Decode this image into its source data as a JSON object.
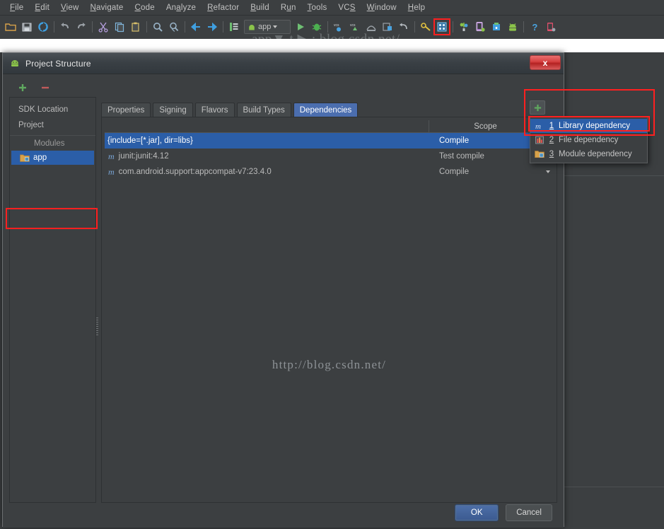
{
  "ide": {
    "menu": [
      {
        "label": "File",
        "mnemonic": "F"
      },
      {
        "label": "Edit",
        "mnemonic": "E"
      },
      {
        "label": "View",
        "mnemonic": "V"
      },
      {
        "label": "Navigate",
        "mnemonic": "N"
      },
      {
        "label": "Code",
        "mnemonic": "C"
      },
      {
        "label": "Analyze",
        "mnemonic": "A"
      },
      {
        "label": "Refactor",
        "mnemonic": "R"
      },
      {
        "label": "Build",
        "mnemonic": "B"
      },
      {
        "label": "Run",
        "mnemonic": "u"
      },
      {
        "label": "Tools",
        "mnemonic": "T"
      },
      {
        "label": "VCS",
        "mnemonic": "S"
      },
      {
        "label": "Window",
        "mnemonic": "W"
      },
      {
        "label": "Help",
        "mnemonic": "H"
      }
    ],
    "toolbar": {
      "run_config_label": "app",
      "icons": [
        "open-folder-icon",
        "save-all-icon",
        "sync-icon",
        "undo-icon",
        "redo-icon",
        "cut-icon",
        "copy-icon",
        "paste-icon",
        "find-icon",
        "replace-icon",
        "back-icon",
        "forward-icon",
        "build-icon",
        "run-config-selector",
        "run-icon",
        "debug-icon",
        "vcs-update-icon",
        "vcs-commit-icon",
        "history-icon",
        "rollback-icon",
        "sdk-manager-icon",
        "project-structure-icon",
        "avd-manager-icon",
        "device-monitor-icon",
        "android-file-icon",
        "android-monitor-icon",
        "help-icon",
        "device-icon"
      ],
      "highlighted_icon": "project-structure-icon",
      "watermark": "app▼ t ▶ : blog.csdn.net/"
    }
  },
  "dialog": {
    "title": "Project Structure",
    "close_label": "x",
    "sidebar": {
      "add_label": "+",
      "remove_label": "−",
      "items": [
        {
          "label": "SDK Location",
          "type": "item",
          "selected": false
        },
        {
          "label": "Project",
          "type": "item",
          "selected": false
        },
        {
          "label": "Modules",
          "type": "group",
          "selected": false
        },
        {
          "label": "app",
          "type": "item",
          "selected": true,
          "icon": "module-folder-icon"
        }
      ]
    },
    "tabs": [
      {
        "label": "Properties",
        "active": false
      },
      {
        "label": "Signing",
        "active": false
      },
      {
        "label": "Flavors",
        "active": false
      },
      {
        "label": "Build Types",
        "active": false
      },
      {
        "label": "Dependencies",
        "active": true
      }
    ],
    "table": {
      "columns": [
        "",
        "Scope"
      ],
      "rows": [
        {
          "name": "{include=[*.jar], dir=libs}",
          "scope": "Compile",
          "selected": true,
          "has_icon": false
        },
        {
          "name": "junit:junit:4.12",
          "scope": "Test compile",
          "selected": false,
          "has_icon": true,
          "icon": "maven-icon"
        },
        {
          "name": "com.android.support:appcompat-v7:23.4.0",
          "scope": "Compile",
          "selected": false,
          "has_icon": true,
          "icon": "maven-icon"
        }
      ]
    },
    "add_menu": {
      "button_label": "+",
      "items": [
        {
          "num": "1",
          "label": "Library dependency",
          "selected": true,
          "icon": "maven-icon"
        },
        {
          "num": "2",
          "label": "File dependency",
          "selected": false,
          "icon": "file-jar-icon"
        },
        {
          "num": "3",
          "label": "Module dependency",
          "selected": false,
          "icon": "module-folder-icon"
        }
      ]
    },
    "watermark": "http://blog.csdn.net/",
    "buttons": {
      "ok": "OK",
      "cancel": "Cancel"
    }
  },
  "colors": {
    "accent": "#2b5ea8",
    "highlight_box": "#ff2020",
    "window_bg": "#3c3f41",
    "primary_button": "#3b5a90"
  }
}
